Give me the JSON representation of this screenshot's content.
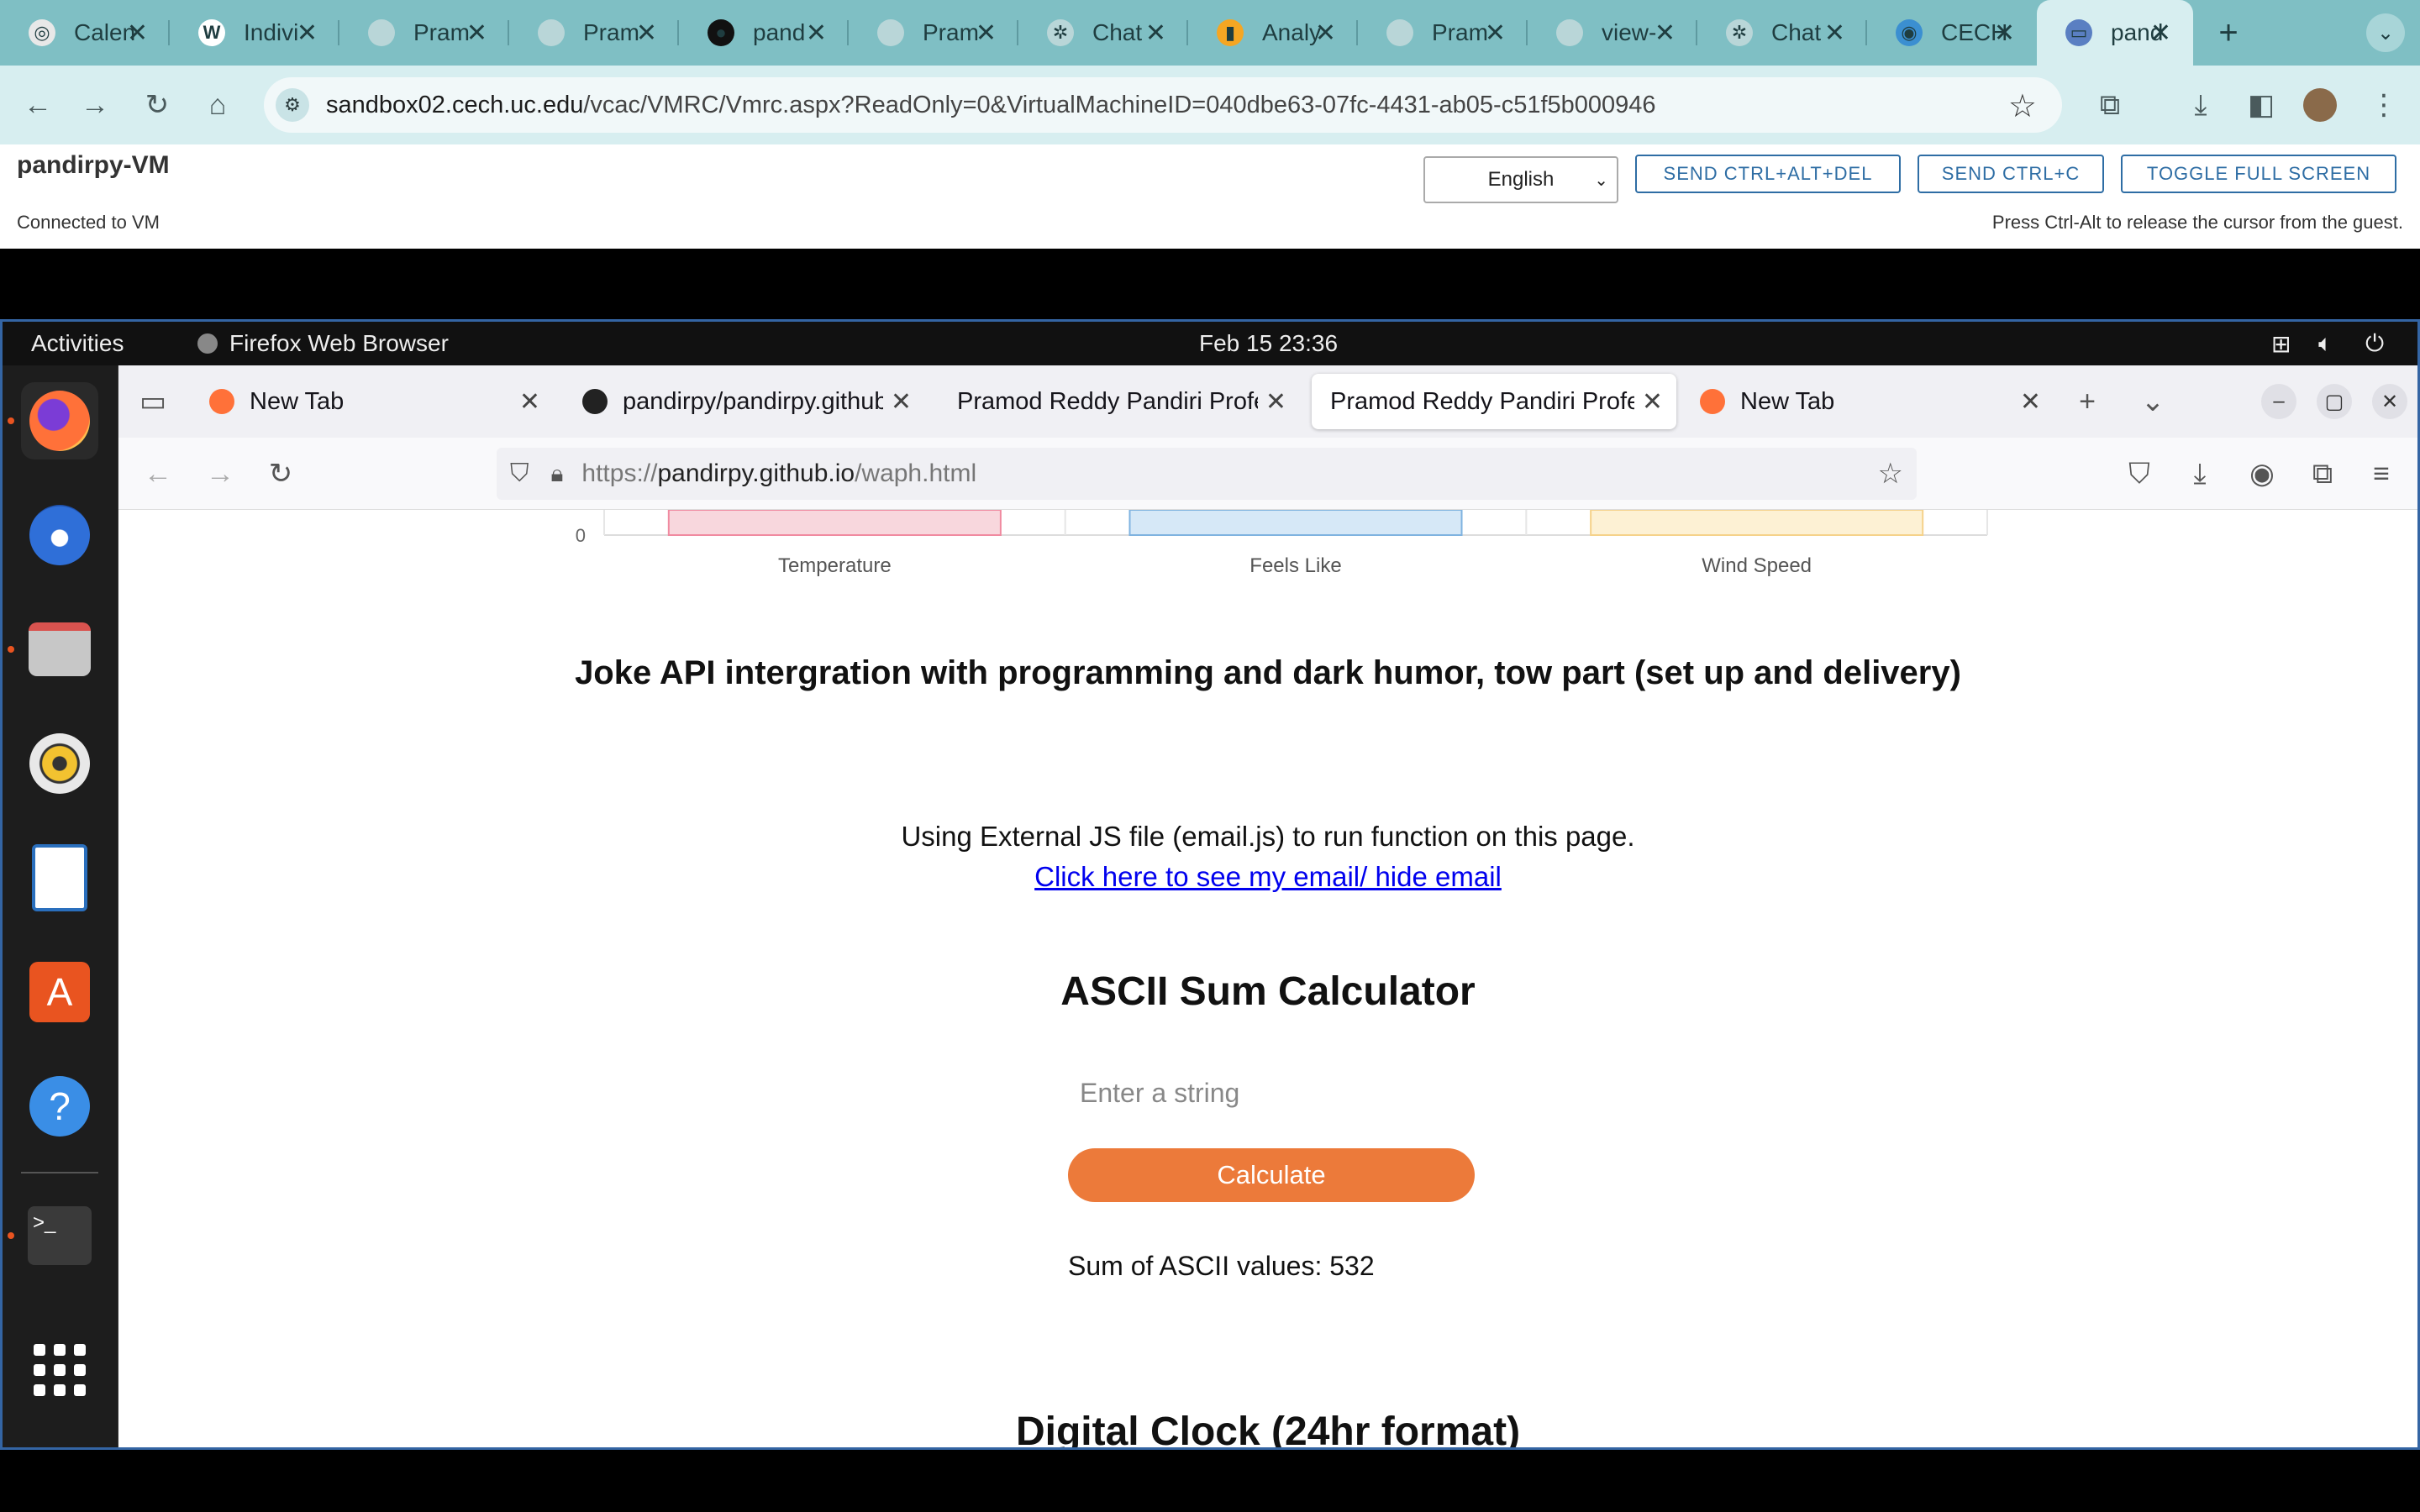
{
  "chrome": {
    "tabs": [
      {
        "title": "Calen",
        "fav_color": "#e8e8e8",
        "fav_glyph": "◎"
      },
      {
        "title": "Indivi",
        "fav_color": "#ffffff",
        "fav_glyph": "W"
      },
      {
        "title": "Pram",
        "fav_color": "#b9d6d8",
        "fav_glyph": ""
      },
      {
        "title": "Pram",
        "fav_color": "#b9d6d8",
        "fav_glyph": ""
      },
      {
        "title": "pand",
        "fav_color": "#111111",
        "fav_glyph": "●"
      },
      {
        "title": "Pram",
        "fav_color": "#b9d6d8",
        "fav_glyph": ""
      },
      {
        "title": "Chat",
        "fav_color": "#b9d6d8",
        "fav_glyph": "✲"
      },
      {
        "title": "Analy",
        "fav_color": "#f5a623",
        "fav_glyph": "▮"
      },
      {
        "title": "Pram",
        "fav_color": "#b9d6d8",
        "fav_glyph": ""
      },
      {
        "title": "view-",
        "fav_color": "#b9d6d8",
        "fav_glyph": ""
      },
      {
        "title": "Chat",
        "fav_color": "#b9d6d8",
        "fav_glyph": "✲"
      },
      {
        "title": "CECH",
        "fav_color": "#3b8fd1",
        "fav_glyph": "◉"
      },
      {
        "title": "pand",
        "fav_color": "#5a7fc2",
        "fav_glyph": "▭"
      }
    ],
    "url_host": "sandbox02.cech.uc.edu",
    "url_path": "/vcac/VMRC/Vmrc.aspx?ReadOnly=0&VirtualMachineID=040dbe63-07fc-4431-ab05-c51f5b000946"
  },
  "vmrc": {
    "vm_name": "pandirpy-VM",
    "status": "Connected to VM",
    "language": "English",
    "btn_ctrl_alt_del": "SEND CTRL+ALT+DEL",
    "btn_ctrl_c": "SEND CTRL+C",
    "btn_fullscreen": "TOGGLE FULL SCREEN",
    "hint": "Press Ctrl-Alt to release the cursor from the guest."
  },
  "gnome": {
    "activities": "Activities",
    "app_name": "Firefox Web Browser",
    "clock": "Feb 15  23:36"
  },
  "firefox": {
    "tabs": [
      {
        "title": "New Tab",
        "fav_color": "#ff7139"
      },
      {
        "title": "pandirpy/pandirpy.github.io",
        "fav_color": "#222222"
      },
      {
        "title": "Pramod Reddy Pandiri Professional",
        "fav_color": ""
      },
      {
        "title": "Pramod Reddy Pandiri Professional",
        "fav_color": ""
      },
      {
        "title": "New Tab",
        "fav_color": "#ff7139"
      }
    ],
    "url_scheme": "https://",
    "url_host": "pandirpy.github.io",
    "url_path": "/waph.html"
  },
  "chart_data": {
    "type": "bar",
    "categories": [
      "Temperature",
      "Feels Like",
      "Wind Speed"
    ],
    "y_tick_visible": "0",
    "colors": [
      "#f8d7dd",
      "#d6e8f7",
      "#fdf1d4"
    ],
    "border_colors": [
      "#f08aa0",
      "#7fb3e0",
      "#f5d28a"
    ]
  },
  "page": {
    "joke_heading": "Joke API intergration with programming and dark humor, tow part (set up and delivery)",
    "js_note": "Using External JS file (email.js) to run function on this page.",
    "email_link": "Click here to see my email/ hide email",
    "ascii_heading": "ASCII Sum Calculator",
    "ascii_placeholder": "Enter a string",
    "calc_label": "Calculate",
    "sum_result": "Sum of ASCII values: 532",
    "clock_heading": "Digital Clock (24hr format)"
  }
}
